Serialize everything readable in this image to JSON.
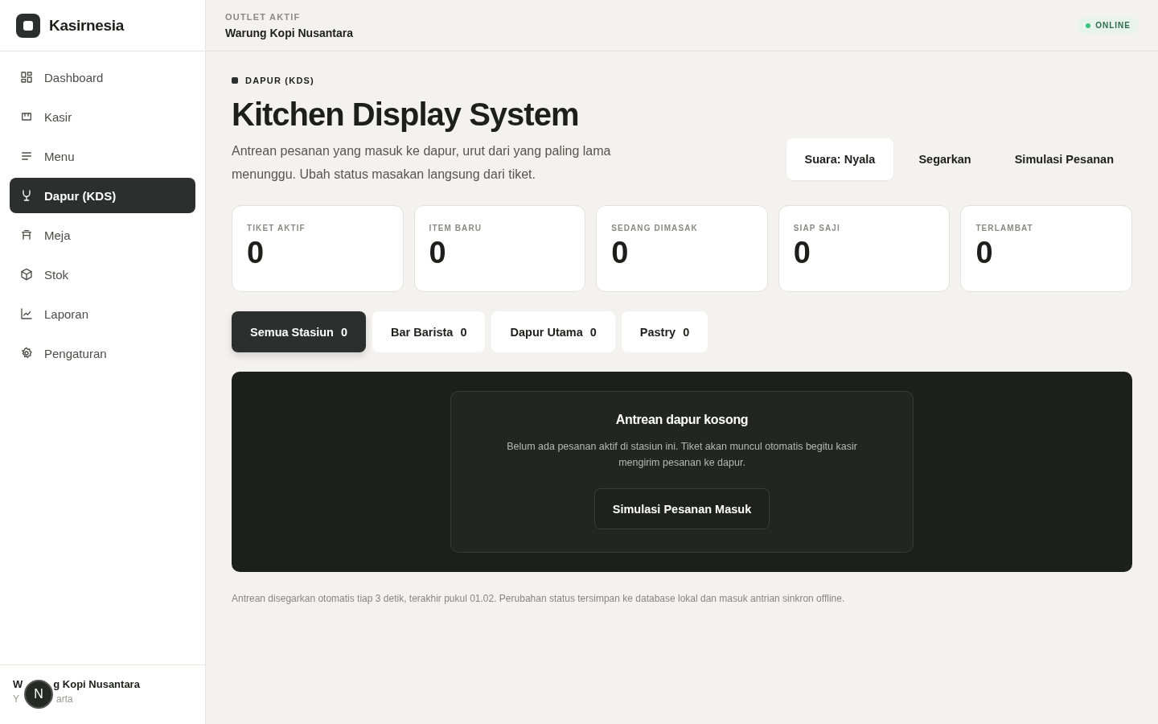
{
  "brand": {
    "name": "Kasirnesia"
  },
  "sidebar": {
    "items": [
      {
        "label": "Dashboard",
        "selected": false
      },
      {
        "label": "Kasir",
        "selected": false
      },
      {
        "label": "Menu",
        "selected": false
      },
      {
        "label": "Dapur (KDS)",
        "selected": true
      },
      {
        "label": "Meja",
        "selected": false
      },
      {
        "label": "Stok",
        "selected": false
      },
      {
        "label": "Laporan",
        "selected": false
      },
      {
        "label": "Pengaturan",
        "selected": false
      }
    ],
    "outlet": {
      "name_parts": [
        "W",
        "g Kopi Nusantara"
      ],
      "city_parts": [
        "Y",
        "arta"
      ]
    }
  },
  "dev_badge": "N",
  "header": {
    "label": "OUTLET AKTIF",
    "outlet": "Warung Kopi Nusantara",
    "status": "ONLINE",
    "online": true
  },
  "page": {
    "eyebrow": "DAPUR (KDS)",
    "title": "Kitchen Display System",
    "description": "Antrean pesanan yang masuk ke dapur, urut dari yang paling lama menunggu. Ubah status masakan langsung dari tiket.",
    "actions": [
      {
        "label": "Suara: Nyala",
        "kind": "filled"
      },
      {
        "label": "Segarkan",
        "kind": "plain"
      },
      {
        "label": "Simulasi Pesanan",
        "kind": "plain"
      }
    ]
  },
  "stats": [
    {
      "label": "TIKET AKTIF",
      "value": "0"
    },
    {
      "label": "ITEM BARU",
      "value": "0"
    },
    {
      "label": "SEDANG DIMASAK",
      "value": "0"
    },
    {
      "label": "SIAP SAJI",
      "value": "0"
    },
    {
      "label": "TERLAMBAT",
      "value": "0"
    }
  ],
  "stations": [
    {
      "label": "Semua Stasiun",
      "count": "0",
      "selected": true
    },
    {
      "label": "Bar Barista",
      "count": "0",
      "selected": false
    },
    {
      "label": "Dapur Utama",
      "count": "0",
      "selected": false
    },
    {
      "label": "Pastry",
      "count": "0",
      "selected": false
    }
  ],
  "empty_state": {
    "title": "Antrean dapur kosong",
    "text": "Belum ada pesanan aktif di stasiun ini. Tiket akan muncul otomatis begitu kasir mengirim pesanan ke dapur.",
    "button": "Simulasi Pesanan Masuk"
  },
  "footnote": "Antrean disegarkan otomatis tiap 3 detik, terakhir pukul 01.02. Perubahan status tersimpan ke database lokal dan masuk antrian sinkron offline."
}
